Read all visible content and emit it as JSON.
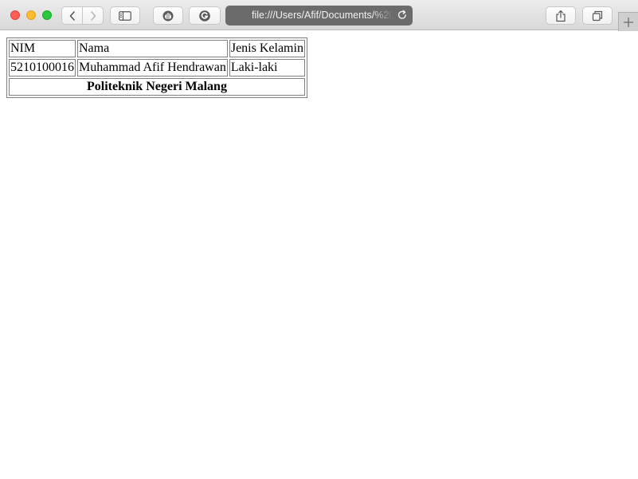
{
  "browser": {
    "url": "file:///Users/Afif/Documents/%20...",
    "icons": {
      "back": "chevron-left-icon",
      "forward": "chevron-right-icon",
      "sidebar": "sidebar-icon",
      "extension_hand": "hand-icon",
      "extension_g": "grammarly-icon",
      "reload": "reload-icon",
      "share": "share-icon",
      "tabs": "tabs-overview-icon",
      "new_tab": "plus-icon"
    }
  },
  "table": {
    "header": [
      "NIM",
      "Nama",
      "Jenis Kelamin"
    ],
    "row": [
      "5210100016",
      "Muhammad Afif Hendrawan",
      "Laki-laki"
    ],
    "footer": "Politeknik Negeri Malang"
  }
}
